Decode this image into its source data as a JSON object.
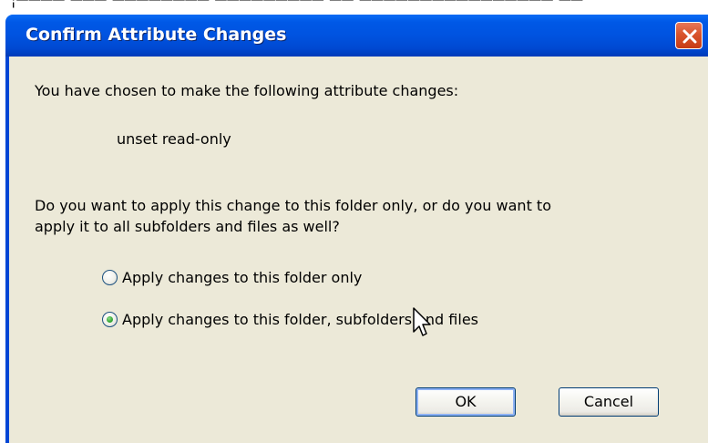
{
  "window": {
    "title": "Confirm Attribute Changes",
    "close_icon": "close-icon"
  },
  "dialog": {
    "intro": "You have chosen to make the following attribute changes:",
    "change": "unset read-only",
    "question_line1": "Do you want to apply this change to this folder only, or do you want to",
    "question_line2": "apply it to all subfolders and files as well?",
    "options": [
      {
        "label": "Apply changes to this folder only",
        "selected": false
      },
      {
        "label": "Apply changes to this folder, subfolders and files",
        "selected": true
      }
    ],
    "ok_label": "OK",
    "cancel_label": "Cancel"
  },
  "colors": {
    "titlebar": "#0053e0",
    "client": "#ece9d8",
    "close": "#d9542b",
    "radio_selected": "#3aa839"
  }
}
